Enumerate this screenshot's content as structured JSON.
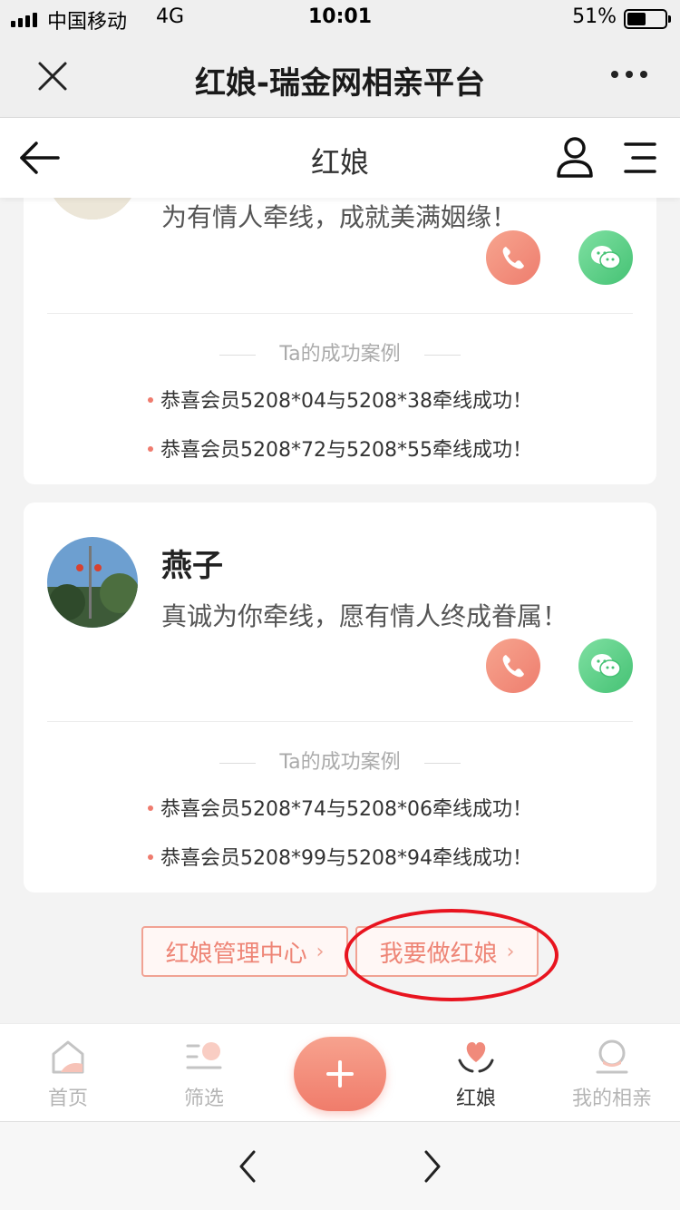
{
  "status_bar": {
    "carrier": "中国移动",
    "network": "4G",
    "time": "10:01",
    "battery_percent": "51%",
    "battery_level": 0.51
  },
  "wechat_bar": {
    "title": "红娘-瑞金网相亲平台"
  },
  "app_header": {
    "title": "红娘"
  },
  "matchmakers": [
    {
      "name": "",
      "slogan": "为有情人牵线，成就美满姻缘！",
      "cases_title": "Ta的成功案例",
      "cases": [
        "恭喜会员5208*04与5208*38牵线成功！",
        "恭喜会员5208*72与5208*55牵线成功！"
      ]
    },
    {
      "name": "燕子",
      "slogan": "真诚为你牵线，愿有情人终成眷属！",
      "cases_title": "Ta的成功案例",
      "cases": [
        "恭喜会员5208*74与5208*06牵线成功！",
        "恭喜会员5208*99与5208*94牵线成功！"
      ]
    }
  ],
  "actions": {
    "manage_center": "红娘管理中心",
    "become_matchmaker": "我要做红娘",
    "chevron": "›"
  },
  "bottom_nav": {
    "items": [
      {
        "label": "首页",
        "icon": "home-icon"
      },
      {
        "label": "筛选",
        "icon": "filter-icon"
      },
      {
        "label": "",
        "icon": "plus-icon"
      },
      {
        "label": "红娘",
        "icon": "matchmaker-icon"
      },
      {
        "label": "我的相亲",
        "icon": "profile-icon"
      }
    ]
  },
  "colors": {
    "accent": "#ee7d6e",
    "wechat_green": "#45c274",
    "highlight_ring": "#e8141f"
  }
}
